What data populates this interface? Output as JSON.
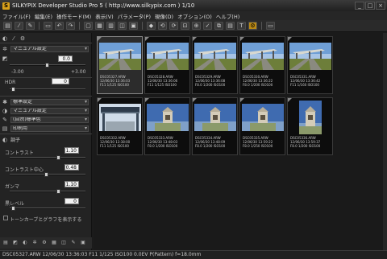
{
  "window": {
    "title": "SILKYPIX Developer Studio Pro 5 ( http://www.silkypix.com )   1/10",
    "controls": [
      "minimize-icon",
      "maximize-icon",
      "close-icon"
    ]
  },
  "menu": [
    "ファイル(F)",
    "編集(E)",
    "操作モード(M)",
    "表示(V)",
    "パラメータ(P)",
    "現像(D)",
    "オプション(O)",
    "ヘルプ(H)"
  ],
  "panel": {
    "wb_preset": "マニュアル設定",
    "slider1_value": "0.0",
    "slider1_min": "-3.00",
    "slider1_max": "+3.00",
    "hdr_label": "HDR",
    "hdr_value": "0",
    "preset_standard": "標準設定",
    "preset_manual": "マニュアル設定",
    "preset_color": "(自然)標準色",
    "preset_mode": "印刷用",
    "tone_tab": "調子",
    "contrast_label": "コントラスト",
    "contrast_value": "1.10",
    "contrast_center_label": "コントラスト中心",
    "contrast_center_value": "0.48",
    "gamma_label": "ガンマ",
    "gamma_value": "1.10",
    "black_level_label": "黒レベル",
    "black_level_value": "0",
    "tone_curve_label": "トーンカーブとグラフを表示する"
  },
  "thumbnails": [
    {
      "file": "DSC05327.ARW",
      "date": "12/06/30 13:36:03",
      "exposure": "F11 1/125 ISO100",
      "scene": "station",
      "selected": true
    },
    {
      "file": "DSC05328.ARW",
      "date": "12/06/30 13:36:06",
      "exposure": "F11 1/125 ISO100",
      "scene": "station",
      "selected": false
    },
    {
      "file": "DSC05329.ARW",
      "date": "12/06/30 13:36:08",
      "exposure": "F8.0 1/200 ISO100",
      "scene": "station",
      "selected": false
    },
    {
      "file": "DSC05330.ARW",
      "date": "12/06/30 13:36:22",
      "exposure": "F8.0 1/200 ISO100",
      "scene": "station",
      "selected": false
    },
    {
      "file": "DSC05331.ARW",
      "date": "12/06/30 13:36:42",
      "exposure": "F11 1/160 ISO100",
      "scene": "station",
      "selected": false
    },
    {
      "file": "DSC05332.ARW",
      "date": "12/06/30 13:38:00",
      "exposure": "F11 1/125 ISO100",
      "scene": "overpass",
      "selected": false
    },
    {
      "file": "DSC05333.ARW",
      "date": "12/06/30 13:48:03",
      "exposure": "F8.0 1/200 ISO100",
      "scene": "tower",
      "selected": false
    },
    {
      "file": "DSC05334.ARW",
      "date": "12/06/30 13:48:09",
      "exposure": "F8.0 1/200 ISO100",
      "scene": "tower",
      "selected": false
    },
    {
      "file": "DSC05335.ARW",
      "date": "12/06/30 13:59:22",
      "exposure": "F8.0 1/250 ISO100",
      "scene": "tower",
      "selected": false
    },
    {
      "file": "DSC05336.ARW",
      "date": "12/06/30 13:59:37",
      "exposure": "F8.0 1/200 ISO100",
      "scene": "tower-portrait",
      "selected": false
    }
  ],
  "status_bar": "DSC05327.ARW 12/06/30 13:36:03 F11 1/125 ISO100   0.0EV P(Pattern) f=18.0mm",
  "colors": {
    "background": "#1b1b1b",
    "panel": "#232323",
    "accent": "#d9a11a"
  }
}
